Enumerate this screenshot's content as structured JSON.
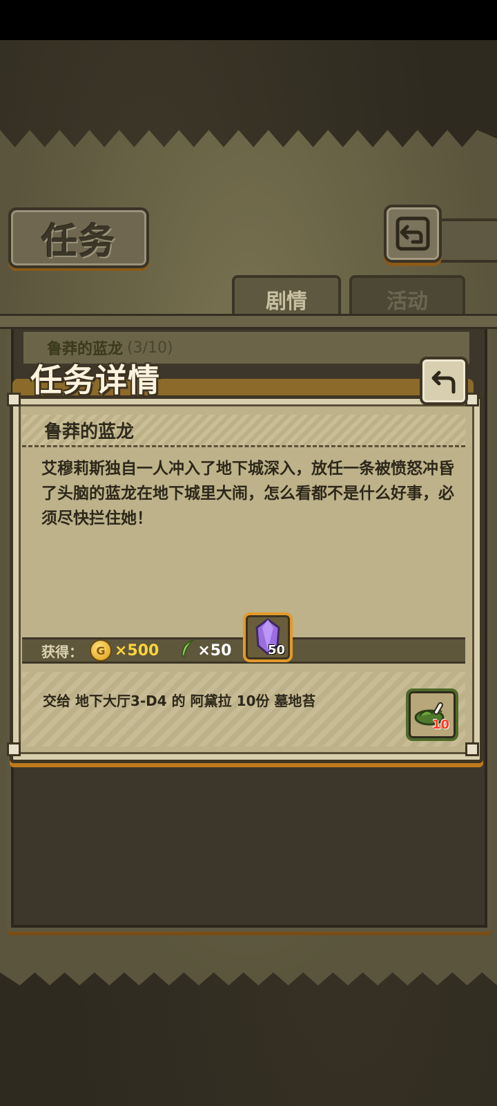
{
  "page": {
    "title": "任务"
  },
  "tabs": [
    {
      "label": "剧情",
      "active": true
    },
    {
      "label": "活动",
      "active": false
    }
  ],
  "quest_list": [
    {
      "name": "鲁莽的蓝龙",
      "progress": "(3/10)"
    }
  ],
  "modal": {
    "title": "任务详情",
    "quest_name": "鲁莽的蓝龙",
    "description": "艾穆莉斯独自一人冲入了地下城深入，放任一条被愤怒冲昏了头脑的蓝龙在地下城里大闹，怎么看都不是什么好事，必须尽快拦住她！",
    "reward_label": "获得：",
    "rewards": {
      "gold": {
        "icon": "gold-coin-icon",
        "icon_letter": "G",
        "amount": "×500"
      },
      "feather": {
        "icon": "feather-icon",
        "amount": "×50"
      },
      "crystal": {
        "icon": "purple-crystal-icon",
        "count": "50"
      }
    },
    "turn_in": {
      "text": "交给 地下大厅3-D4 的 阿黛拉 10份 墓地苔",
      "item_icon": "graveyard-moss-icon",
      "item_count": "10"
    }
  },
  "colors": {
    "gold_text": "#ffd43a",
    "accent_orange": "#c07a1e",
    "moss_count": "#ff3b2a"
  }
}
